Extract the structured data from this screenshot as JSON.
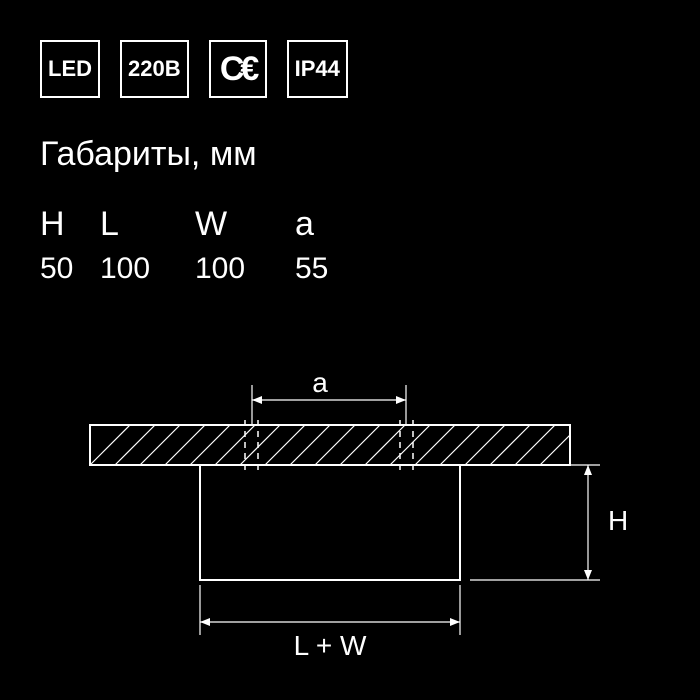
{
  "badges": {
    "led": "LED",
    "voltage": "220В",
    "ce": "C€",
    "ip": "IP44"
  },
  "section_title": "Габариты, мм",
  "dimensions": {
    "headers": {
      "h": "H",
      "l": "L",
      "w": "W",
      "a": "a"
    },
    "values": {
      "h": "50",
      "l": "100",
      "w": "100",
      "a": "55"
    }
  },
  "diagram_labels": {
    "a": "a",
    "h": "H",
    "lw": "L + W"
  }
}
